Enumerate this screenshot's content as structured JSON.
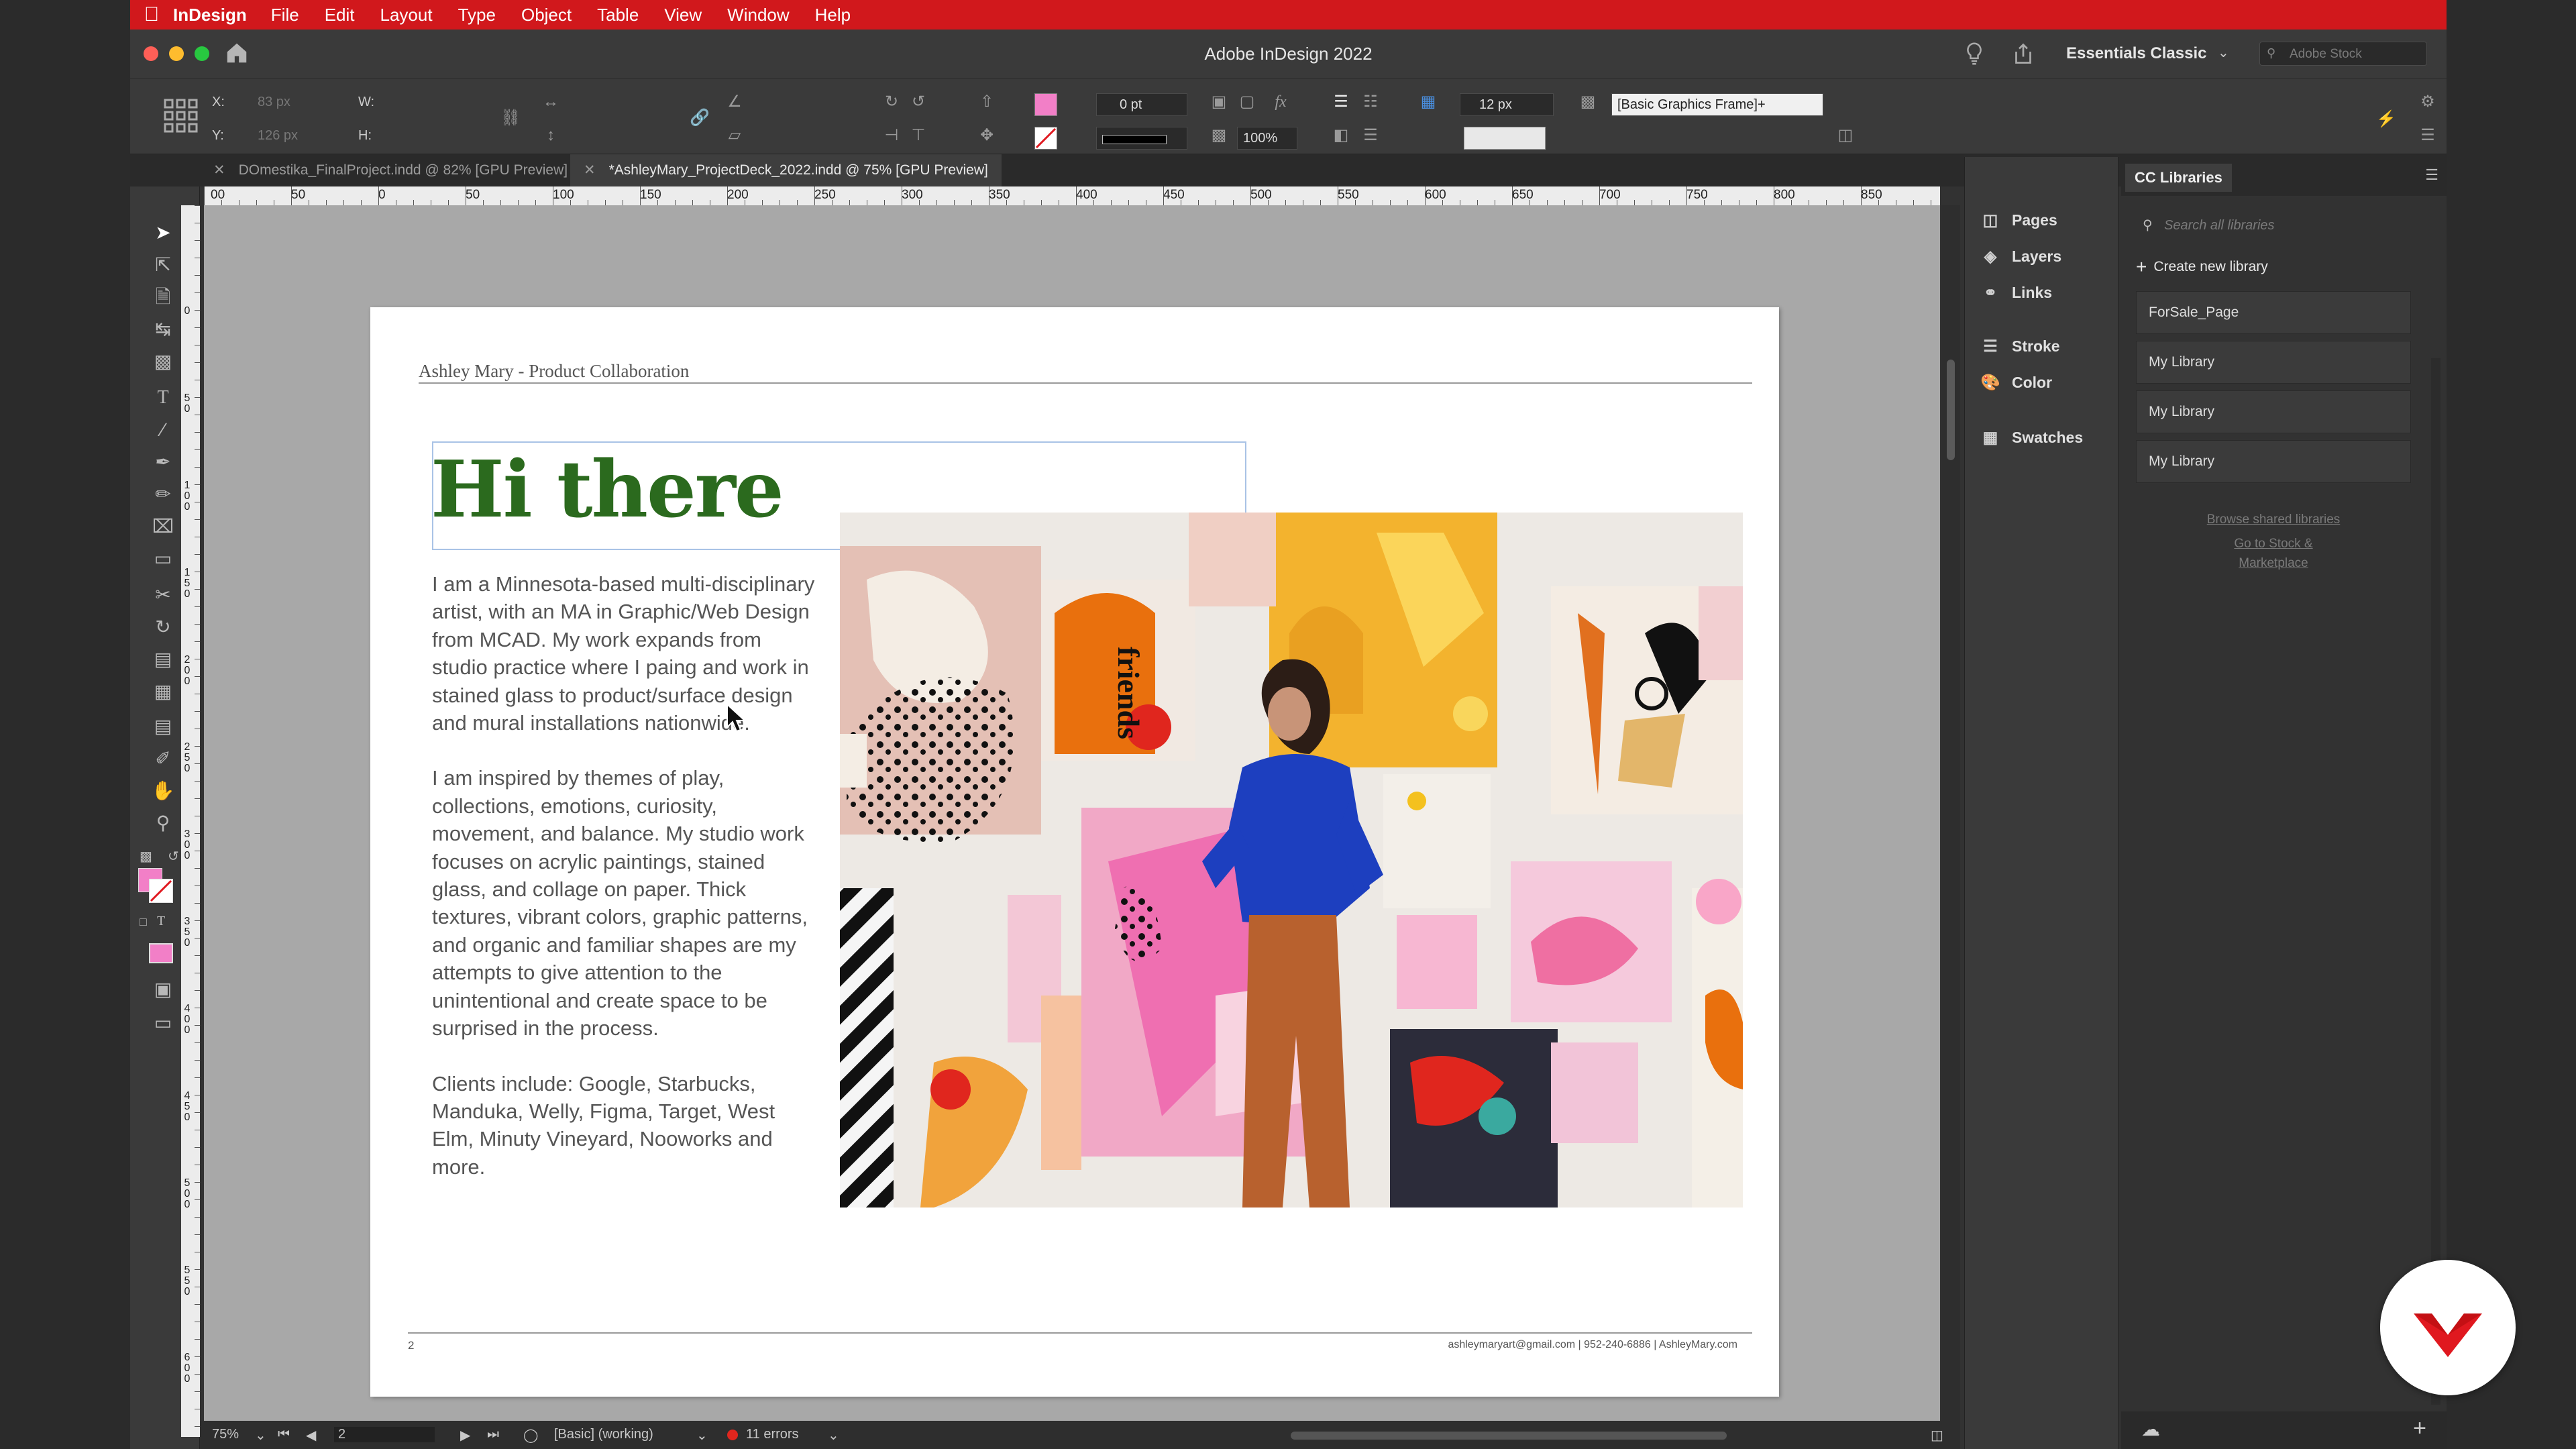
{
  "menubar": {
    "app_name": "InDesign",
    "items": [
      "File",
      "Edit",
      "Layout",
      "Type",
      "Object",
      "Table",
      "View",
      "Window",
      "Help"
    ]
  },
  "window": {
    "title": "Adobe InDesign 2022",
    "workspace": "Essentials Classic",
    "stock_search_placeholder": "Adobe Stock"
  },
  "control_panel": {
    "x_label": "X:",
    "x_value": "83 px",
    "y_label": "Y:",
    "y_value": "126 px",
    "w_label": "W:",
    "w_value": "",
    "h_label": "H:",
    "h_value": "",
    "stroke_weight": "0 pt",
    "opacity": "100%",
    "gap": "12 px",
    "object_style": "[Basic Graphics Frame]+",
    "fill_color": "#f27fc7"
  },
  "tabs": [
    {
      "label": "DOmestika_FinalProject.indd @ 82% [GPU Preview]",
      "active": false
    },
    {
      "label": "*AshleyMary_ProjectDeck_2022.indd @ 75% [GPU Preview]",
      "active": true
    }
  ],
  "ruler": {
    "h_ticks": [
      "00",
      "50",
      "0",
      "50",
      "100",
      "150",
      "200",
      "250",
      "300",
      "350",
      "400",
      "450",
      "500",
      "550",
      "600",
      "650",
      "700",
      "750",
      "800",
      "850"
    ],
    "v_ticks": [
      "0",
      "50",
      "100",
      "150",
      "200",
      "250",
      "300",
      "350",
      "400",
      "450",
      "500",
      "550",
      "600"
    ]
  },
  "page": {
    "header": "Ashley Mary - Product Collaboration",
    "heading": "Hi there",
    "paragraphs": [
      "I am a Minnesota-based multi-disciplinary artist, with an MA in Graphic/Web Design from MCAD. My work expands from studio practice where I paing and work in stained glass to product/surface design and mural installations nationwide.",
      "I am inspired by themes of play, collections, emotions, curiosity, movement, and balance. My studio work focuses on acrylic paintings, stained glass, and collage on paper. Thick textures, vibrant colors, graphic patterns, and organic and familiar shapes are my attempts to give attention to the unintentional and create space to be surprised in the process.",
      "Clients include: Google, Starbucks, Manduka, Welly, Figma, Target, West Elm, Minuty Vineyard, Nooworks and more."
    ],
    "photo_sign": "friends",
    "footer_page": "2",
    "footer_contact": "ashleymaryart@gmail.com | 952-240-6886 | AshleyMary.com",
    "heading_color": "#2b6a1e"
  },
  "statusbar": {
    "zoom": "75%",
    "page_number": "2",
    "preflight_profile": "[Basic] (working)",
    "errors": "11 errors"
  },
  "panels": {
    "items": [
      "Pages",
      "Layers",
      "Links",
      "Stroke",
      "Color",
      "Swatches"
    ]
  },
  "cc_libraries": {
    "title": "CC Libraries",
    "search_placeholder": "Search all libraries",
    "create_label": "Create new library",
    "libraries": [
      "ForSale_Page",
      "My Library",
      "My Library",
      "My Library"
    ],
    "browse_link": "Browse shared libraries",
    "stock_link": "Go to Stock & Marketplace"
  },
  "colors": {
    "menubar": "#d1181c",
    "accent_red": "#e0181f"
  }
}
